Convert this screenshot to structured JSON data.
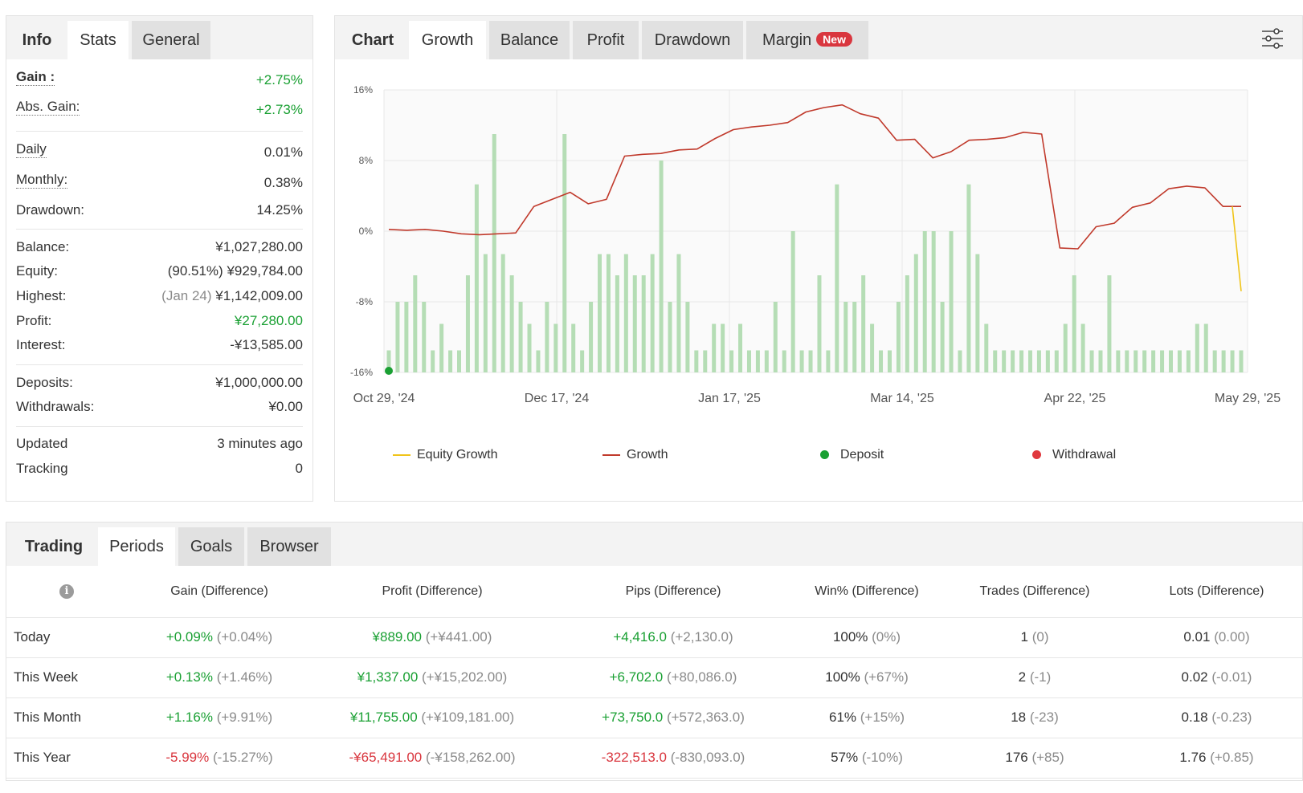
{
  "info_panel": {
    "tabs": [
      {
        "label": "Info"
      },
      {
        "label": "Stats"
      },
      {
        "label": "General"
      }
    ],
    "gain": {
      "label": "Gain :",
      "value": "+2.75%"
    },
    "abs_gain": {
      "label": "Abs. Gain:",
      "value": "+2.73%"
    },
    "daily": {
      "label": "Daily",
      "value": "0.01%"
    },
    "monthly": {
      "label": "Monthly:",
      "value": "0.38%"
    },
    "drawdown": {
      "label": "Drawdown:",
      "value": "14.25%"
    },
    "balance": {
      "label": "Balance:",
      "value": "¥1,027,280.00"
    },
    "equity": {
      "label": "Equity:",
      "pct": "(90.51%)",
      "value": "¥929,784.00"
    },
    "highest": {
      "label": "Highest:",
      "date": "(Jan 24)",
      "value": "¥1,142,009.00"
    },
    "profit": {
      "label": "Profit:",
      "value": "¥27,280.00"
    },
    "interest": {
      "label": "Interest:",
      "value": "-¥13,585.00"
    },
    "deposits": {
      "label": "Deposits:",
      "value": "¥1,000,000.00"
    },
    "withdrawals": {
      "label": "Withdrawals:",
      "value": "¥0.00"
    },
    "updated": {
      "label": "Updated",
      "value": "3 minutes ago"
    },
    "tracking": {
      "label": "Tracking",
      "value": "0"
    }
  },
  "chart_panel": {
    "tabs": [
      {
        "label": "Chart"
      },
      {
        "label": "Growth"
      },
      {
        "label": "Balance"
      },
      {
        "label": "Profit"
      },
      {
        "label": "Drawdown"
      },
      {
        "label": "Margin"
      }
    ],
    "margin_badge": "New",
    "settings_icon": "sliders-icon",
    "legend": [
      {
        "label": "Equity Growth",
        "color": "#f0c419",
        "marker": "line"
      },
      {
        "label": "Growth",
        "color": "#c0392b",
        "marker": "line"
      },
      {
        "label": "Deposit",
        "color": "#1aa033",
        "marker": "dot"
      },
      {
        "label": "Withdrawal",
        "color": "#e0393e",
        "marker": "dot"
      }
    ]
  },
  "chart_data": {
    "type": "line",
    "ylim": [
      -16,
      16
    ],
    "y_ticks": [
      "16%",
      "8%",
      "0%",
      "-8%",
      "-16%"
    ],
    "x_tick_labels": [
      "Oct 29, '24",
      "Dec 17, '24",
      "Jan 17, '25",
      "Mar 14, '25",
      "Apr 22, '25",
      "May 29, '25"
    ],
    "growth": [
      0.2,
      0.1,
      0.2,
      0.0,
      -0.3,
      -0.4,
      -0.3,
      -0.2,
      2.8,
      3.6,
      4.4,
      3.1,
      3.6,
      8.5,
      8.7,
      8.8,
      9.2,
      9.3,
      10.5,
      11.5,
      11.8,
      12.0,
      12.3,
      13.5,
      14.0,
      14.3,
      13.3,
      12.8,
      10.3,
      10.4,
      8.3,
      9.0,
      10.3,
      10.4,
      10.6,
      11.2,
      11.0,
      -1.9,
      -2.0,
      0.5,
      0.9,
      2.7,
      3.2,
      4.8,
      5.1,
      4.9,
      2.8,
      2.8
    ],
    "equity_growth": [
      2.8,
      -6.8
    ],
    "deposit": {
      "x": 0,
      "y": -16
    },
    "bars": [
      -13.5,
      -8,
      -8,
      -5,
      -8,
      -13.5,
      -10.5,
      -13.5,
      -13.5,
      -5,
      5.3,
      -2.6,
      11,
      -2.6,
      -5,
      -8,
      -10.5,
      -13.5,
      -8,
      -10.5,
      11,
      -10.5,
      -13.5,
      -8,
      -2.6,
      -2.6,
      -5,
      -2.6,
      -5,
      -5,
      -2.6,
      8,
      -8,
      -2.6,
      -8,
      -13.5,
      -13.5,
      -10.5,
      -10.5,
      -13.5,
      -10.5,
      -13.5,
      -13.5,
      -13.5,
      -8,
      -13.5,
      0,
      -13.5,
      -13.5,
      -5,
      -13.5,
      5.3,
      -8,
      -8,
      -5,
      -10.5,
      -13.5,
      -13.5,
      -8,
      -5,
      -2.6,
      0,
      0,
      -8,
      0,
      -13.5,
      5.3,
      -2.6,
      -10.5,
      -13.5,
      -13.5,
      -13.5,
      -13.5,
      -13.5,
      -13.5,
      -13.5,
      -13.5,
      -10.5,
      -5,
      -10.5,
      -13.5,
      -13.5,
      -5,
      -13.5,
      -13.5,
      -13.5,
      -13.5,
      -13.5,
      -13.5,
      -13.5,
      -13.5,
      -13.5,
      -10.5,
      -10.5,
      -13.5,
      -13.5,
      -13.5,
      -13.5
    ]
  },
  "trading_panel": {
    "tabs": [
      {
        "label": "Trading"
      },
      {
        "label": "Periods"
      },
      {
        "label": "Goals"
      },
      {
        "label": "Browser"
      }
    ],
    "info_icon": "info-icon",
    "columns": [
      "Gain (Difference)",
      "Profit (Difference)",
      "Pips (Difference)",
      "Win% (Difference)",
      "Trades (Difference)",
      "Lots (Difference)"
    ],
    "rows": [
      {
        "period": "Today",
        "gain": "+0.09%",
        "gain_diff": "(+0.04%)",
        "profit": "¥889.00",
        "profit_diff": "(+¥441.00)",
        "pips": "+4,416.0",
        "pips_diff": "(+2,130.0)",
        "win": "100%",
        "win_diff": "(0%)",
        "trades": "1",
        "trades_diff": "(0)",
        "lots": "0.01",
        "lots_diff": "(0.00)",
        "sign": "pos"
      },
      {
        "period": "This Week",
        "gain": "+0.13%",
        "gain_diff": "(+1.46%)",
        "profit": "¥1,337.00",
        "profit_diff": "(+¥15,202.00)",
        "pips": "+6,702.0",
        "pips_diff": "(+80,086.0)",
        "win": "100%",
        "win_diff": "(+67%)",
        "trades": "2",
        "trades_diff": "(-1)",
        "lots": "0.02",
        "lots_diff": "(-0.01)",
        "sign": "pos"
      },
      {
        "period": "This Month",
        "gain": "+1.16%",
        "gain_diff": "(+9.91%)",
        "profit": "¥11,755.00",
        "profit_diff": "(+¥109,181.00)",
        "pips": "+73,750.0",
        "pips_diff": "(+572,363.0)",
        "win": "61%",
        "win_diff": "(+15%)",
        "trades": "18",
        "trades_diff": "(-23)",
        "lots": "0.18",
        "lots_diff": "(-0.23)",
        "sign": "pos"
      },
      {
        "period": "This Year",
        "gain": "-5.99%",
        "gain_diff": "(-15.27%)",
        "profit": "-¥65,491.00",
        "profit_diff": "(-¥158,262.00)",
        "pips": "-322,513.0",
        "pips_diff": "(-830,093.0)",
        "win": "57%",
        "win_diff": "(-10%)",
        "trades": "176",
        "trades_diff": "(+85)",
        "lots": "1.76",
        "lots_diff": "(+0.85)",
        "sign": "neg"
      }
    ]
  }
}
